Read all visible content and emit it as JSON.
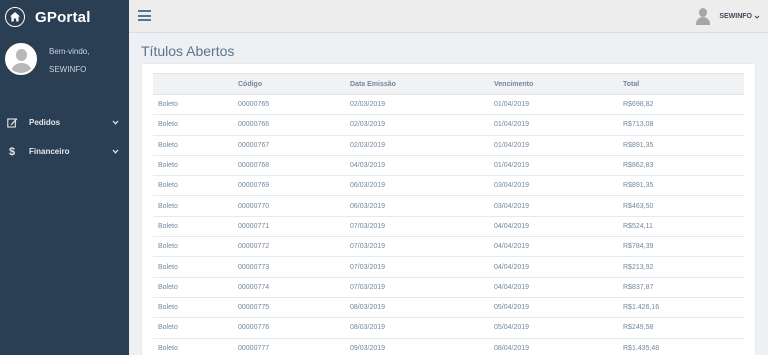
{
  "brand": {
    "name": "GPortal"
  },
  "profile": {
    "welcome": "Bem-vindo,",
    "username": "SEWINFO"
  },
  "menu": [
    {
      "label": "Pedidos",
      "icon": "edit-icon"
    },
    {
      "label": "Financeiro",
      "icon": "dollar-icon"
    }
  ],
  "topbar": {
    "user": "SEWINFO"
  },
  "page": {
    "title": "Títulos Abertos"
  },
  "table": {
    "headers": [
      "",
      "Código",
      "Data Emissão",
      "Vencimento",
      "Total"
    ],
    "rows": [
      [
        "Boleto",
        "00000765",
        "02/03/2019",
        "01/04/2019",
        "R$698,82"
      ],
      [
        "Boleto",
        "00000766",
        "02/03/2019",
        "01/04/2019",
        "R$713,08"
      ],
      [
        "Boleto",
        "00000767",
        "02/03/2019",
        "01/04/2019",
        "R$891,35"
      ],
      [
        "Boleto",
        "00000768",
        "04/03/2019",
        "01/04/2019",
        "R$862,83"
      ],
      [
        "Boleto",
        "00000769",
        "06/03/2019",
        "03/04/2019",
        "R$891,35"
      ],
      [
        "Boleto",
        "00000770",
        "06/03/2019",
        "03/04/2019",
        "R$463,50"
      ],
      [
        "Boleto",
        "00000771",
        "07/03/2019",
        "04/04/2019",
        "R$524,11"
      ],
      [
        "Boleto",
        "00000772",
        "07/03/2019",
        "04/04/2019",
        "R$784,39"
      ],
      [
        "Boleto",
        "00000773",
        "07/03/2019",
        "04/04/2019",
        "R$213,92"
      ],
      [
        "Boleto",
        "00000774",
        "07/03/2019",
        "04/04/2019",
        "R$837,87"
      ],
      [
        "Boleto",
        "00000775",
        "08/03/2019",
        "05/04/2019",
        "R$1.426,16"
      ],
      [
        "Boleto",
        "00000776",
        "08/03/2019",
        "05/04/2019",
        "R$249,58"
      ],
      [
        "Boleto",
        "00000777",
        "09/03/2019",
        "08/04/2019",
        "R$1.435,48"
      ]
    ]
  }
}
